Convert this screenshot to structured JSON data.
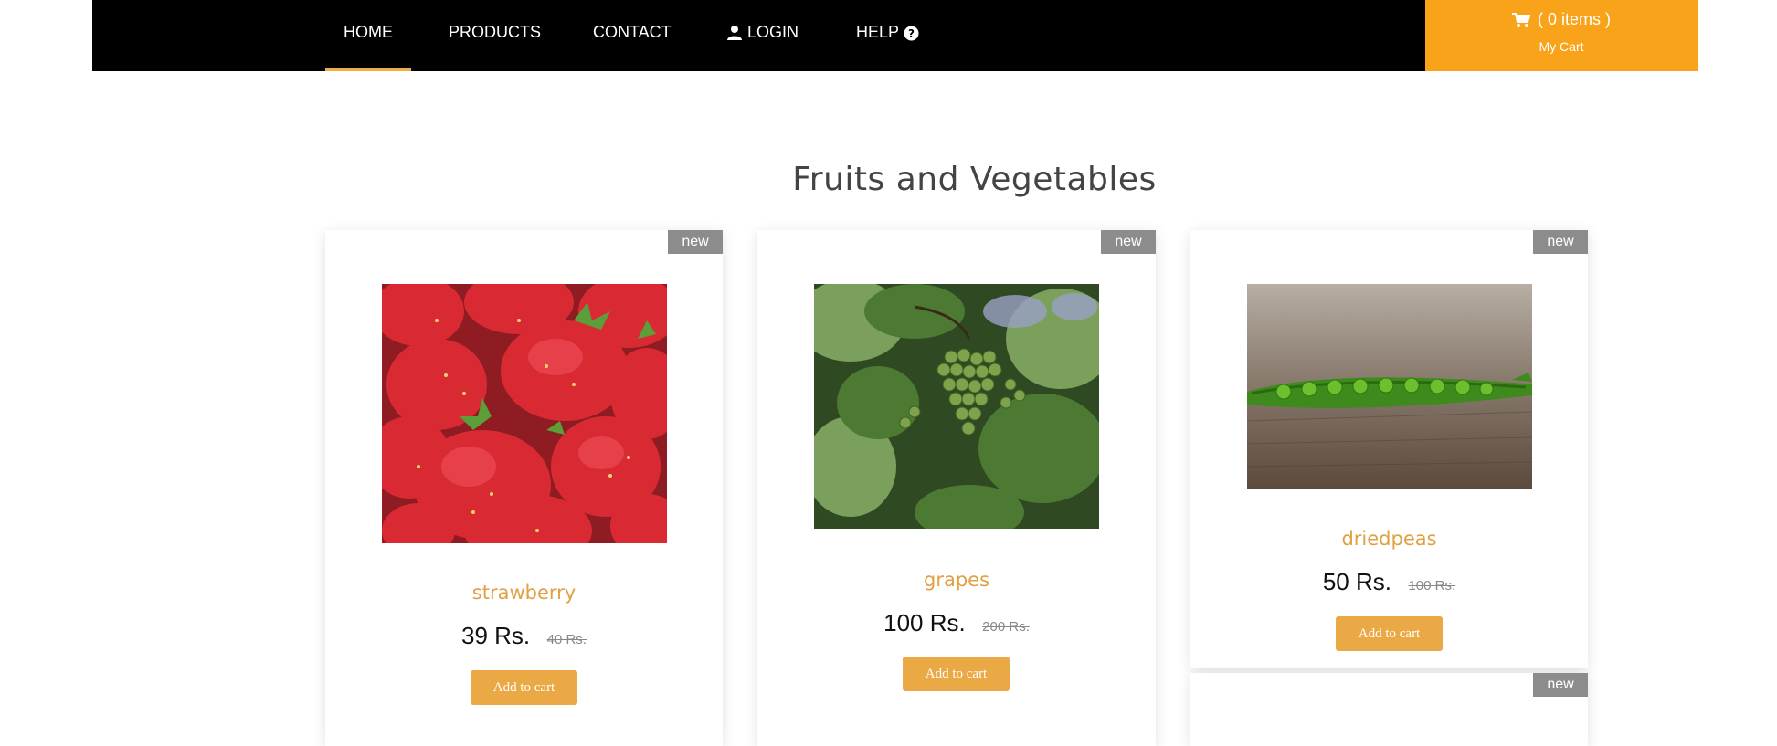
{
  "nav": {
    "home": "HOME",
    "products": "PRODUCTS",
    "contact": "CONTACT",
    "login": "LOGIN",
    "help": "HELP"
  },
  "cart": {
    "items": "( 0 items )",
    "label": "My Cart"
  },
  "section_title": "Fruits and Vegetables",
  "products": [
    {
      "badge": "new",
      "name": "strawberry",
      "price": "39 Rs.",
      "old_price": "40 Rs.",
      "button": "Add to cart"
    },
    {
      "badge": "new",
      "name": "grapes",
      "price": "100 Rs.",
      "old_price": "200 Rs.",
      "button": "Add to cart"
    },
    {
      "badge": "new",
      "name": "driedpeas",
      "price": "50 Rs.",
      "old_price": "100 Rs.",
      "button": "Add to cart"
    },
    {
      "badge": "new"
    }
  ],
  "colors": {
    "nav_bg": "#000000",
    "cart_bg": "#f8a31a",
    "accent": "#eba946",
    "badge_bg": "#8c8c8c"
  }
}
